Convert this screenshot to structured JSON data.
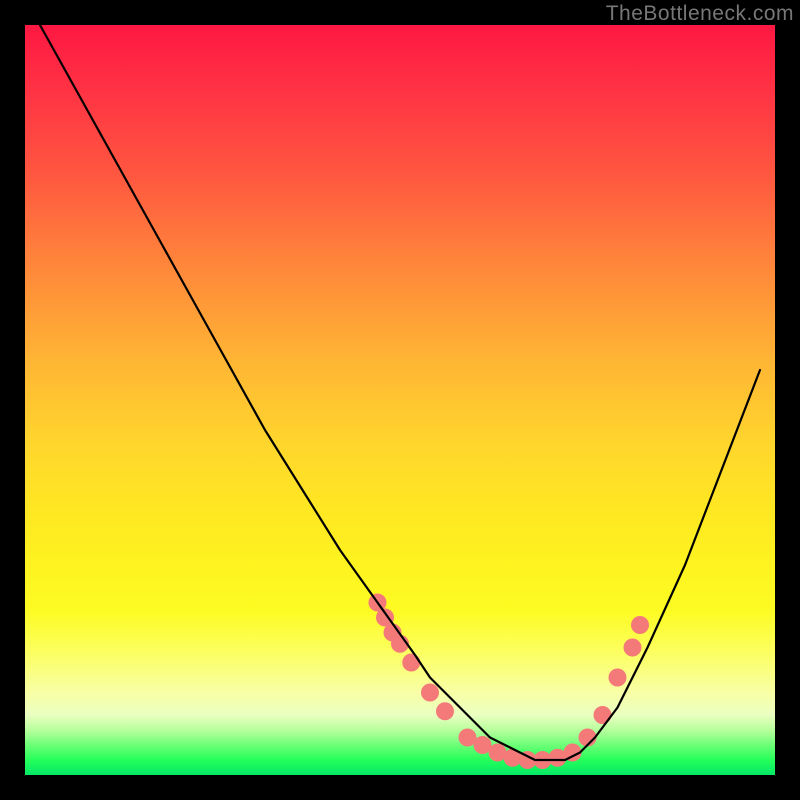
{
  "watermark": "TheBottleneck.com",
  "chart_data": {
    "type": "line",
    "title": "",
    "xlabel": "",
    "ylabel": "",
    "xlim": [
      0,
      100
    ],
    "ylim": [
      0,
      100
    ],
    "grid": false,
    "legend": false,
    "series": [
      {
        "name": "bottleneck-curve",
        "color": "#000000",
        "x": [
          2,
          7,
          12,
          17,
          22,
          27,
          32,
          37,
          42,
          47,
          52,
          54,
          56,
          58,
          60,
          62,
          64,
          66,
          68,
          70,
          72,
          74,
          76,
          79,
          83,
          88,
          93,
          98
        ],
        "y": [
          100,
          91,
          82,
          73,
          64,
          55,
          46,
          38,
          30,
          23,
          16,
          13,
          11,
          9,
          7,
          5,
          4,
          3,
          2,
          2,
          2,
          3,
          5,
          9,
          17,
          28,
          41,
          54
        ]
      }
    ],
    "markers": {
      "name": "highlight-dots",
      "color": "#f47a7a",
      "radius": 9,
      "points_xy": [
        [
          47,
          23
        ],
        [
          48,
          21
        ],
        [
          49,
          19
        ],
        [
          50,
          17.5
        ],
        [
          51.5,
          15
        ],
        [
          54,
          11
        ],
        [
          56,
          8.5
        ],
        [
          59,
          5
        ],
        [
          61,
          4
        ],
        [
          63,
          3
        ],
        [
          65,
          2.3
        ],
        [
          67,
          2
        ],
        [
          69,
          2
        ],
        [
          71,
          2.3
        ],
        [
          73,
          3
        ],
        [
          75,
          5
        ],
        [
          77,
          8
        ],
        [
          79,
          13
        ],
        [
          81,
          17
        ],
        [
          82,
          20
        ]
      ]
    }
  }
}
